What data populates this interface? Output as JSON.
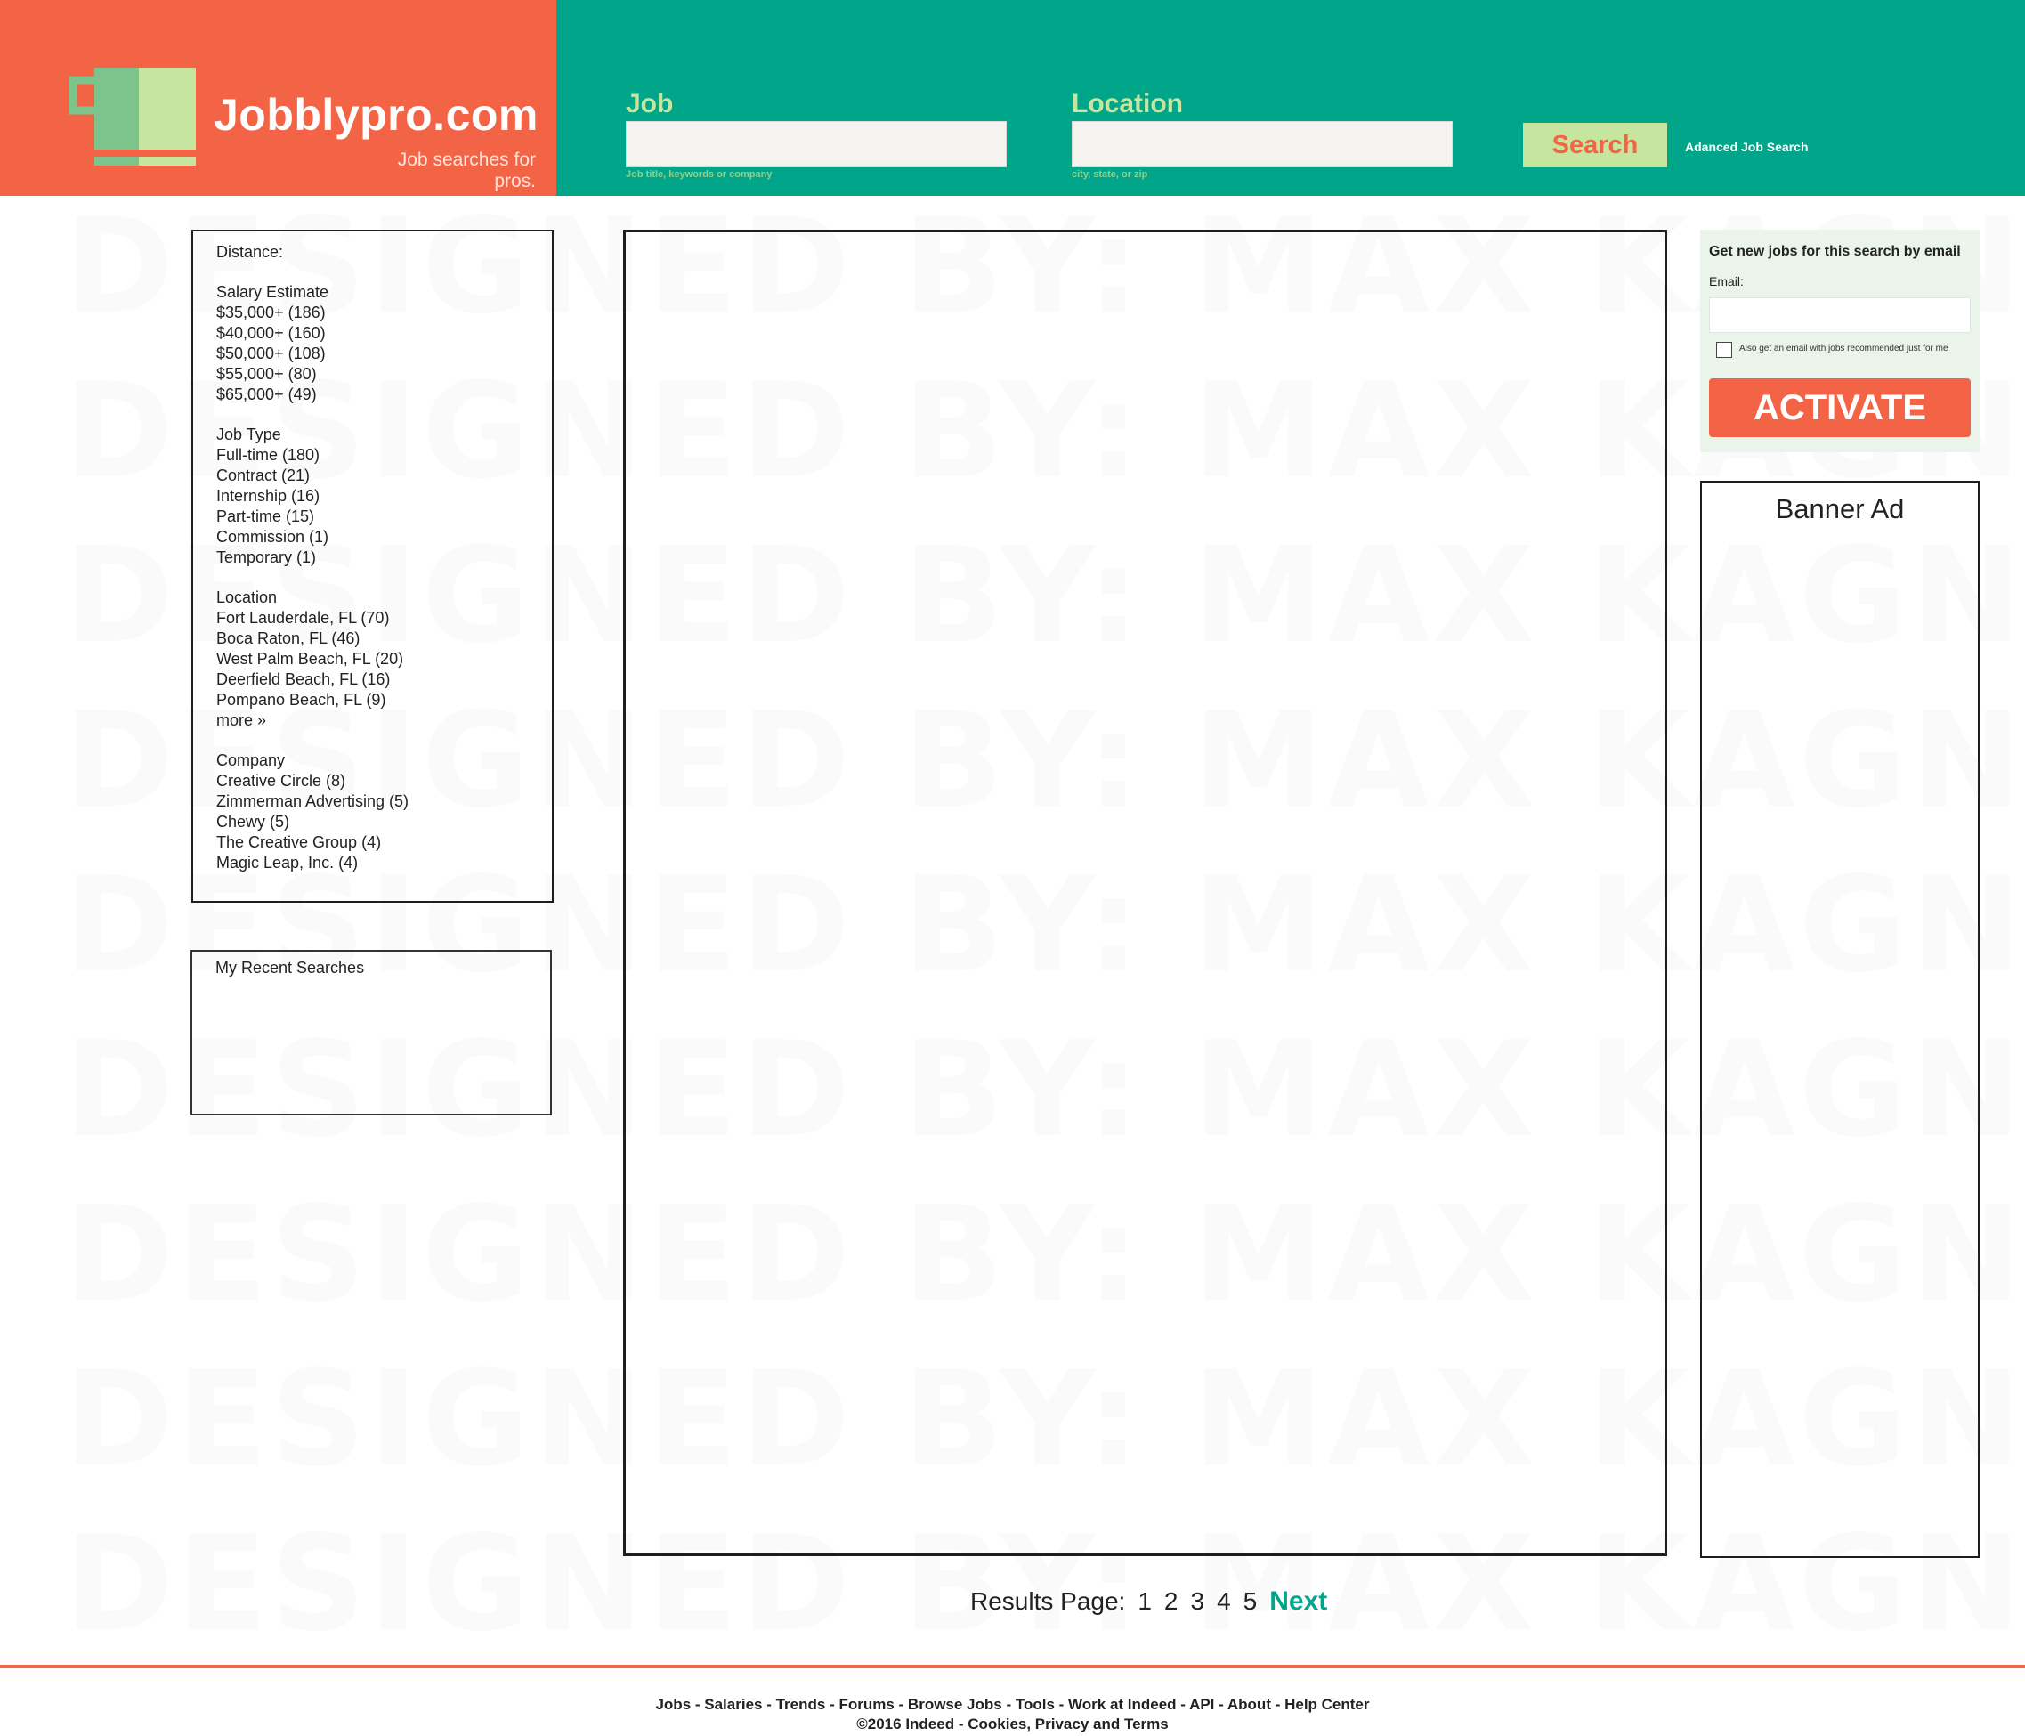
{
  "header": {
    "brand_name": "Jobblypro.com",
    "brand_tagline": "Job searches for pros.",
    "logo_icon": "coffee-mug-icon",
    "job_label": "Job",
    "job_value": "",
    "job_hint": "Job title, keywords or company",
    "location_label": "Location",
    "location_value": "",
    "location_hint": "city, state, or zip",
    "search_label": "Search",
    "advanced_link": "Adanced Job Search",
    "colors": {
      "brand": "#f26445",
      "bar": "#00a58a",
      "accent": "#c6e6a0"
    }
  },
  "filters": {
    "distance_label": "Distance:",
    "salary": {
      "heading": "Salary Estimate",
      "items": [
        "$35,000+ (186)",
        "$40,000+ (160)",
        "$50,000+ (108)",
        "$55,000+ (80)",
        "$65,000+ (49)"
      ]
    },
    "job_type": {
      "heading": "Job Type",
      "items": [
        "Full-time (180)",
        "Contract (21)",
        "Internship (16)",
        "Part-time (15)",
        "Commission (1)",
        "Temporary (1)"
      ]
    },
    "location": {
      "heading": "Location",
      "items": [
        "Fort Lauderdale, FL (70)",
        "Boca Raton, FL (46)",
        "West Palm Beach, FL (20)",
        "Deerfield Beach, FL (16)",
        "Pompano Beach, FL (9)"
      ],
      "more": "more »"
    },
    "company": {
      "heading": "Company",
      "items": [
        "Creative Circle (8)",
        "Zimmerman Advertising (5)",
        "Chewy (5)",
        "The Creative Group (4)",
        "Magic Leap, Inc. (4)"
      ]
    }
  },
  "recent": {
    "title": "My Recent Searches"
  },
  "alert": {
    "title": "Get new jobs for this search by email",
    "email_label": "Email:",
    "email_value": "",
    "checkbox_label": "Also get an email with jobs recommended just for me",
    "checkbox_checked": false,
    "button": "ACTIVATE"
  },
  "banner": {
    "label": "Banner Ad"
  },
  "pagination": {
    "label": "Results Page:",
    "pages": [
      "1",
      "2",
      "3",
      "4",
      "5"
    ],
    "next": "Next"
  },
  "footer": {
    "links": [
      "Jobs",
      "Salaries",
      "Trends",
      "Forums",
      "Browse Jobs",
      "Tools",
      "Work at Indeed",
      "API",
      "About",
      "Help Center"
    ],
    "copyright": "©2016 Indeed",
    "copyright_link": "Cookies, Privacy and Terms"
  },
  "watermark": "DESIGNED BY: MAX KAGNO"
}
